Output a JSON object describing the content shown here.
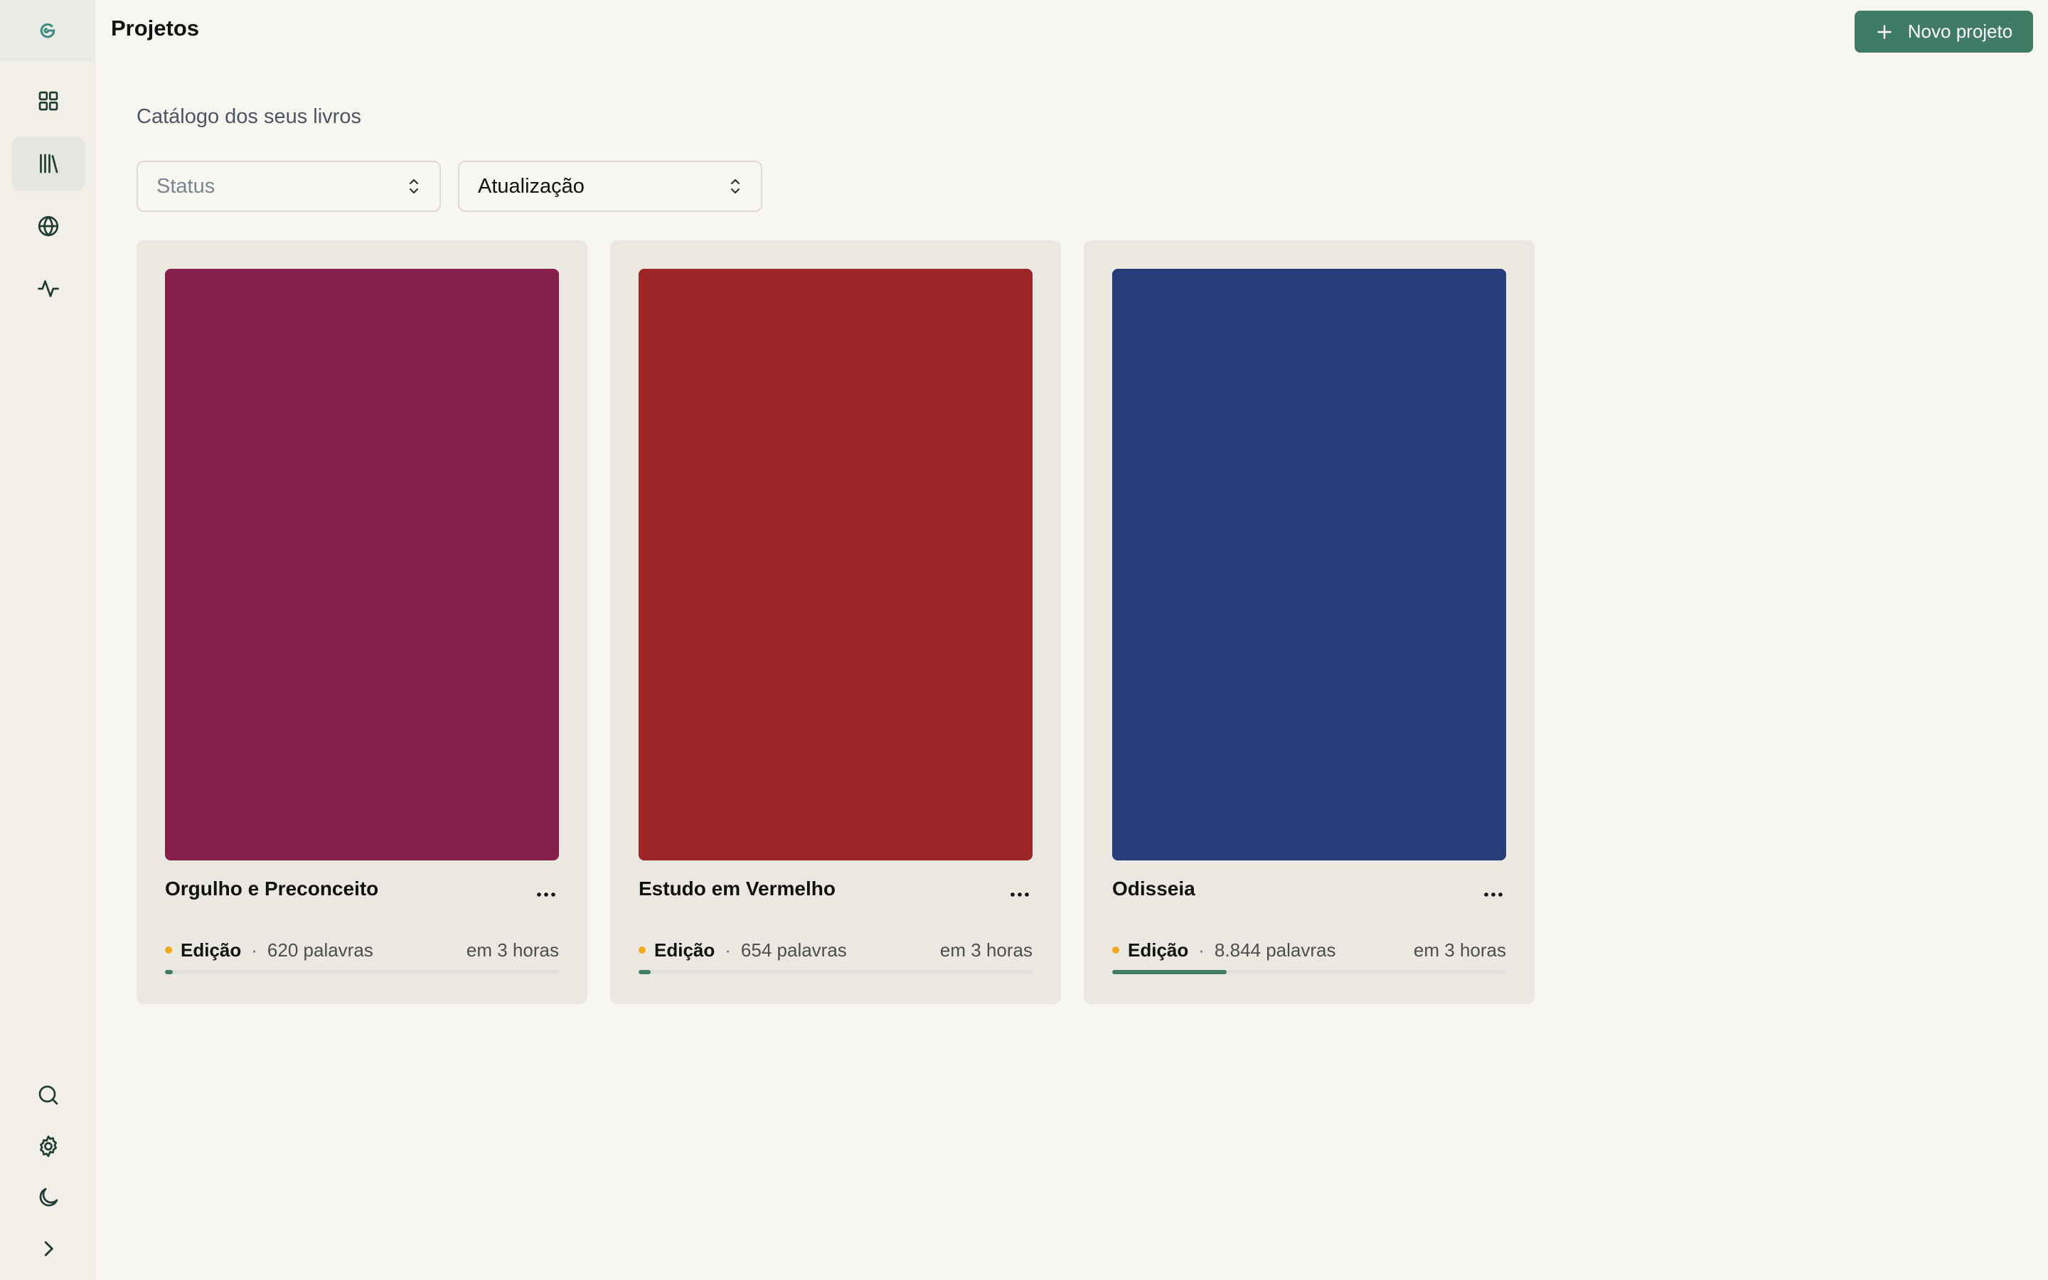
{
  "header": {
    "title": "Projetos",
    "new_project_label": "Novo projeto"
  },
  "sidebar": {
    "logo_icon": "swirl-logo-icon",
    "items": [
      {
        "name": "dashboard",
        "icon": "grid-icon",
        "active": false
      },
      {
        "name": "library",
        "icon": "library-icon",
        "active": true
      },
      {
        "name": "world",
        "icon": "globe-icon",
        "active": false
      },
      {
        "name": "activity",
        "icon": "activity-icon",
        "active": false
      }
    ],
    "bottom_items": [
      {
        "name": "search",
        "icon": "search-icon"
      },
      {
        "name": "settings",
        "icon": "gear-icon"
      },
      {
        "name": "theme",
        "icon": "moon-icon"
      },
      {
        "name": "expand",
        "icon": "chevron-right-icon"
      }
    ]
  },
  "main": {
    "subtitle": "Catálogo dos seus livros",
    "filters": {
      "status_placeholder": "Status",
      "sort_value": "Atualização"
    },
    "books": [
      {
        "title": "Orgulho e Preconceito",
        "status": "Edição",
        "words": "620 palavras",
        "updated": "em 3 horas",
        "cover_color": "#861f49",
        "progress": 0.02
      },
      {
        "title": "Estudo em Vermelho",
        "status": "Edição",
        "words": "654 palavras",
        "updated": "em 3 horas",
        "cover_color": "#9b2527",
        "progress": 0.03
      },
      {
        "title": "Odisseia",
        "status": "Edição",
        "words": "8.844 palavras",
        "updated": "em 3 horas",
        "cover_color": "#283b7a",
        "progress": 0.29
      }
    ]
  },
  "colors": {
    "accent": "#3f7b65",
    "status_dot": "#f0a920",
    "background": "#f8f6f1"
  }
}
